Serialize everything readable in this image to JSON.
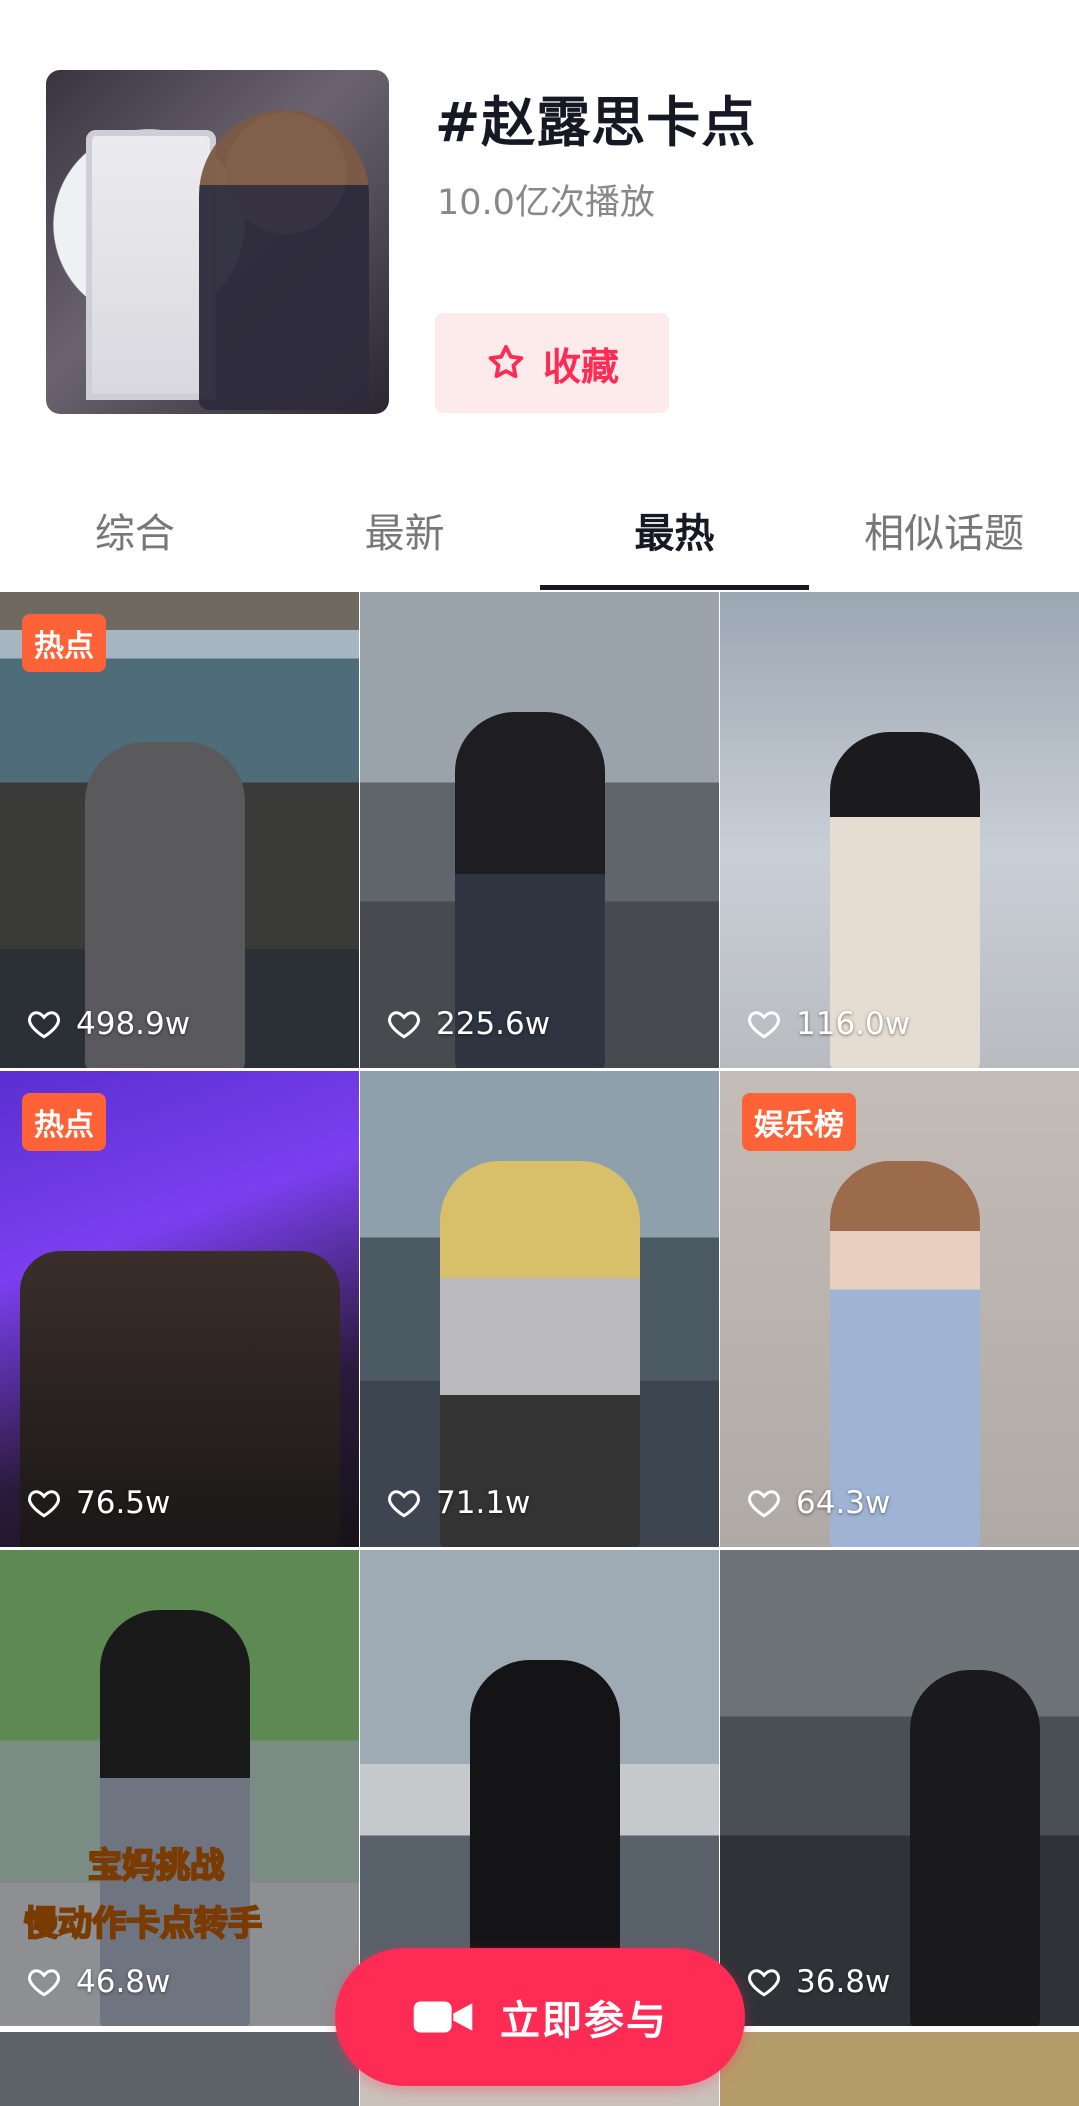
{
  "topic": {
    "title": "#赵露思卡点",
    "plays": "10.0亿次播放",
    "favorite_label": "收藏"
  },
  "tabs": [
    {
      "label": "综合",
      "active": false
    },
    {
      "label": "最新",
      "active": false
    },
    {
      "label": "最热",
      "active": true
    },
    {
      "label": "相似话题",
      "active": false
    }
  ],
  "videos": [
    {
      "badge": "热点",
      "likes": "498.9w"
    },
    {
      "badge": "",
      "likes": "225.6w"
    },
    {
      "badge": "",
      "likes": "116.0w"
    },
    {
      "badge": "热点",
      "likes": "76.5w"
    },
    {
      "badge": "",
      "likes": "71.1w"
    },
    {
      "badge": "娱乐榜",
      "likes": "64.3w"
    },
    {
      "badge": "",
      "likes": "46.8w",
      "overlay_line1": "宝妈挑战",
      "overlay_line2": "慢动作卡点转手"
    },
    {
      "badge": "",
      "likes": "",
      "overlay_line1": "",
      "overlay_line2": ""
    },
    {
      "badge": "",
      "likes": "36.8w"
    }
  ],
  "join_button_label": "立即参与",
  "colors": {
    "accent": "#fe2c55",
    "badge": "#ff6236",
    "fav_bg": "#fdebec"
  }
}
